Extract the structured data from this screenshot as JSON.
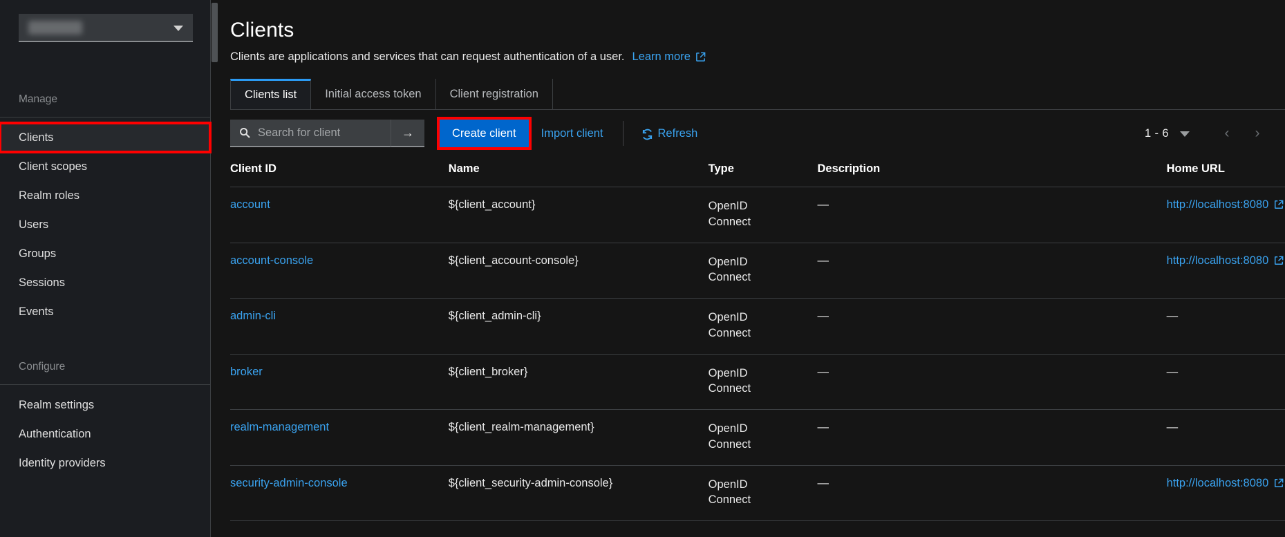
{
  "sidebar": {
    "realm_selector": {
      "name": "realm-selector",
      "label_redacted": true,
      "caret": "chevron-down-icon"
    },
    "sections": [
      {
        "label": "Manage",
        "items": [
          {
            "label": "Clients",
            "active": true,
            "annotated": true
          },
          {
            "label": "Client scopes"
          },
          {
            "label": "Realm roles"
          },
          {
            "label": "Users"
          },
          {
            "label": "Groups"
          },
          {
            "label": "Sessions"
          },
          {
            "label": "Events"
          }
        ]
      },
      {
        "label": "Configure",
        "items": [
          {
            "label": "Realm settings"
          },
          {
            "label": "Authentication"
          },
          {
            "label": "Identity providers"
          }
        ]
      }
    ]
  },
  "header": {
    "title": "Clients",
    "description": "Clients are applications and services that can request authentication of a user.",
    "learn_more": "Learn more"
  },
  "tabs": [
    {
      "label": "Clients list",
      "active": true
    },
    {
      "label": "Initial access token",
      "active": false
    },
    {
      "label": "Client registration",
      "active": false
    }
  ],
  "toolbar": {
    "search_placeholder": "Search for client",
    "search_value": "",
    "search_submit": "→",
    "create_label": "Create client",
    "import_label": "Import client",
    "refresh_label": "Refresh",
    "pagination": {
      "range": "1 - 6",
      "prev": "‹",
      "next": "›"
    }
  },
  "table": {
    "columns": [
      "Client ID",
      "Name",
      "Type",
      "Description",
      "Home URL",
      ""
    ],
    "rows": [
      {
        "client_id": "account",
        "name": "${client_account}",
        "type": "OpenID Connect",
        "description": "—",
        "home_url": "http://localhost:8080"
      },
      {
        "client_id": "account-console",
        "name": "${client_account-console}",
        "type": "OpenID Connect",
        "description": "—",
        "home_url": "http://localhost:8080"
      },
      {
        "client_id": "admin-cli",
        "name": "${client_admin-cli}",
        "type": "OpenID Connect",
        "description": "—",
        "home_url": "—"
      },
      {
        "client_id": "broker",
        "name": "${client_broker}",
        "type": "OpenID Connect",
        "description": "—",
        "home_url": "—"
      },
      {
        "client_id": "realm-management",
        "name": "${client_realm-management}",
        "type": "OpenID Connect",
        "description": "—",
        "home_url": "—"
      },
      {
        "client_id": "security-admin-console",
        "name": "${client_security-admin-console}",
        "type": "OpenID Connect",
        "description": "—",
        "home_url": "http://localhost:8080"
      }
    ]
  },
  "colors": {
    "accent_blue": "#0066cc",
    "link_blue": "#3aa3f0",
    "annotation_red": "#ff0000",
    "sidebar_bg": "#1b1d21",
    "main_bg": "#151515",
    "border": "#3c3f42"
  }
}
